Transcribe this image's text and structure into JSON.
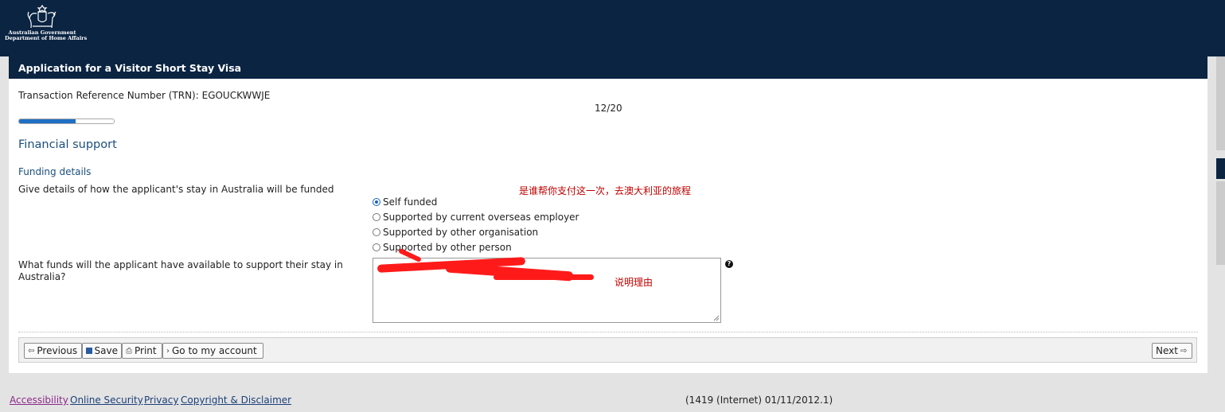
{
  "header": {
    "logo": {
      "line1": "Australian Government",
      "line2": "Department of Home Affairs"
    }
  },
  "panel": {
    "title": "Application for a Visitor Short Stay Visa"
  },
  "trn": {
    "label": "Transaction Reference Number (TRN):",
    "value": "EGOUCKWWJE"
  },
  "progress": {
    "text": "12/20",
    "fraction": 0.6
  },
  "section": {
    "title": "Financial support",
    "subtitle": "Funding details"
  },
  "questions": {
    "q1": "Give details of how the applicant's stay in Australia will be funded",
    "q2": "What funds will the applicant have available to support their stay in Australia?"
  },
  "radios": [
    {
      "label": "Self funded",
      "checked": true
    },
    {
      "label": "Supported by current overseas employer",
      "checked": false
    },
    {
      "label": "Supported by other organisation",
      "checked": false
    },
    {
      "label": "Supported by other person",
      "checked": false
    }
  ],
  "annotations": {
    "a1": "是谁帮你支付这一次，去澳大利亚的旅程",
    "a2": "说明理由"
  },
  "help_icon": "question-mark-icon",
  "buttons": {
    "previous": "Previous",
    "save": "Save",
    "print": "Print",
    "account": "Go to my account",
    "next": "Next"
  },
  "footer": {
    "links": [
      "Accessibility",
      "Online Security",
      "Privacy",
      "Copyright & Disclaimer"
    ],
    "version": "(1419 (Internet) 01/11/2012.1)"
  },
  "colors": {
    "brand_navy": "#0a2442",
    "link_blue": "#1b4f7e",
    "progress_blue": "#1f6fc5",
    "annotation_red": "#c00000"
  }
}
